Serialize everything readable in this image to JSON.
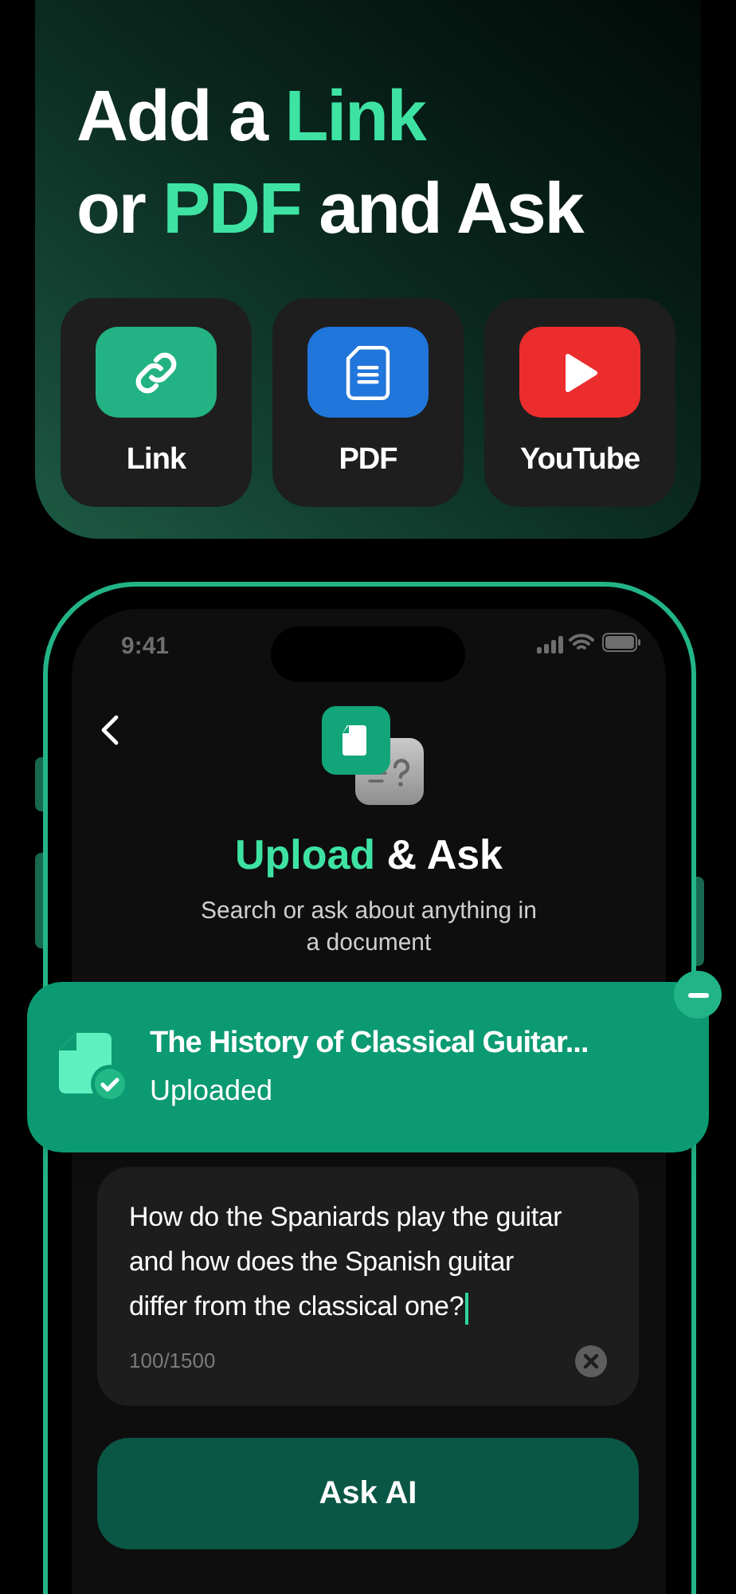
{
  "headline": [
    [
      {
        "text": "Add a ",
        "accent": false
      },
      {
        "text": "Link",
        "accent": true
      }
    ],
    [
      {
        "text": "or ",
        "accent": false
      },
      {
        "text": "PDF",
        "accent": true
      },
      {
        "text": " and Ask",
        "accent": false
      }
    ]
  ],
  "sources": [
    {
      "label": "Link",
      "kind": "link"
    },
    {
      "label": "PDF",
      "kind": "pdf"
    },
    {
      "label": "YouTube",
      "kind": "youtube"
    }
  ],
  "phone": {
    "status_bar": {
      "time": "9:41"
    },
    "title": [
      {
        "text": "Upload",
        "accent": true
      },
      {
        "text": " & Ask",
        "accent": false
      }
    ],
    "subtitle": "Search or ask about anything in a document",
    "upload_toast": {
      "title": "The History of Classical Guitar...",
      "status": "Uploaded"
    },
    "question_field": {
      "value": "How do the Spaniards play the guitar and how does the Spanish guitar differ from the classical one?",
      "counter": "100/1500"
    },
    "ask_button": "Ask AI"
  }
}
